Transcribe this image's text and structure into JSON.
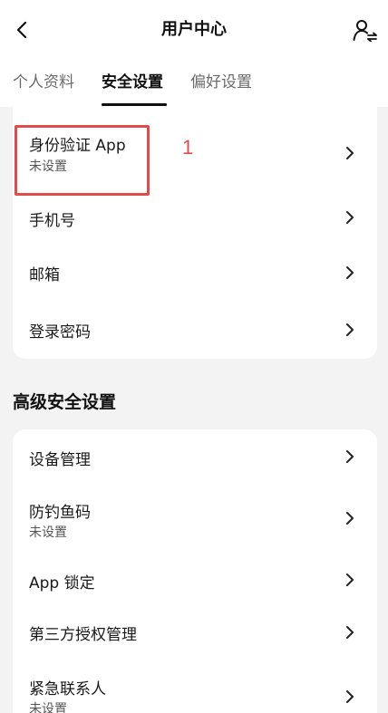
{
  "header": {
    "title": "用户中心",
    "back_icon": "chevron-left-icon",
    "switch_icon": "user-switch-icon"
  },
  "tabs": [
    {
      "label": "个人资料",
      "active": false
    },
    {
      "label": "安全设置",
      "active": true
    },
    {
      "label": "偏好设置",
      "active": false
    }
  ],
  "security": {
    "items": [
      {
        "label": "身份验证 App",
        "sub": "未设置"
      },
      {
        "label": "手机号"
      },
      {
        "label": "邮箱"
      },
      {
        "label": "登录密码"
      }
    ]
  },
  "advanced": {
    "title": "高级安全设置",
    "items": [
      {
        "label": "设备管理"
      },
      {
        "label": "防钓鱼码",
        "sub": "未设置"
      },
      {
        "label": "App 锁定"
      },
      {
        "label": "第三方授权管理"
      },
      {
        "label": "紧急联系人",
        "sub": "未设置"
      }
    ]
  },
  "annotation": {
    "number": "1",
    "color": "#e24b4b"
  },
  "colors": {
    "background": "#f3f3f3",
    "card": "#ffffff",
    "text": "#1a1a1a",
    "muted": "#6b6b6b"
  }
}
